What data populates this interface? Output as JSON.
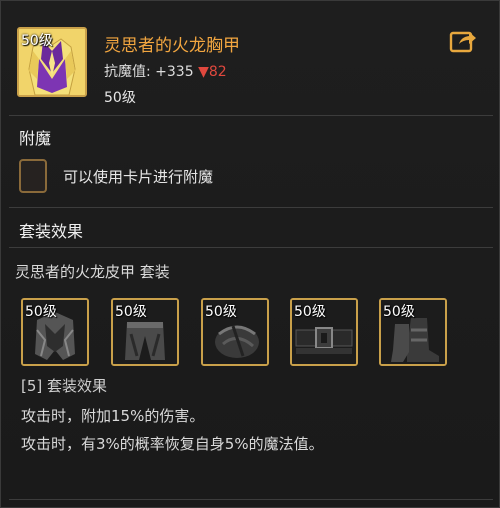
{
  "item": {
    "level_tag": "50级",
    "name": "灵思者的火龙胸甲",
    "stat_label": "抗魔值: +335",
    "stat_down": "▼82",
    "level": "50级",
    "share_icon": "share-icon"
  },
  "enchant": {
    "title": "附魔",
    "slot_text": "可以使用卡片进行附魔"
  },
  "set": {
    "title": "套装效果",
    "name": "灵思者的火龙皮甲  套装",
    "pieces": [
      {
        "level_tag": "50级",
        "icon": "helmet-icon"
      },
      {
        "level_tag": "50级",
        "icon": "pants-icon"
      },
      {
        "level_tag": "50级",
        "icon": "shoulder-icon"
      },
      {
        "level_tag": "50级",
        "icon": "belt-icon"
      },
      {
        "level_tag": "50级",
        "icon": "boots-icon"
      }
    ],
    "bonus_title": "[5] 套装效果",
    "bonus_lines": [
      "攻击时，附加15%的伤害。",
      "攻击时，有3%的概率恢复自身5%的魔法值。"
    ]
  },
  "colors": {
    "name": "#f2a640",
    "stat_down": "#e0483e",
    "frame": "#c9a04a"
  }
}
